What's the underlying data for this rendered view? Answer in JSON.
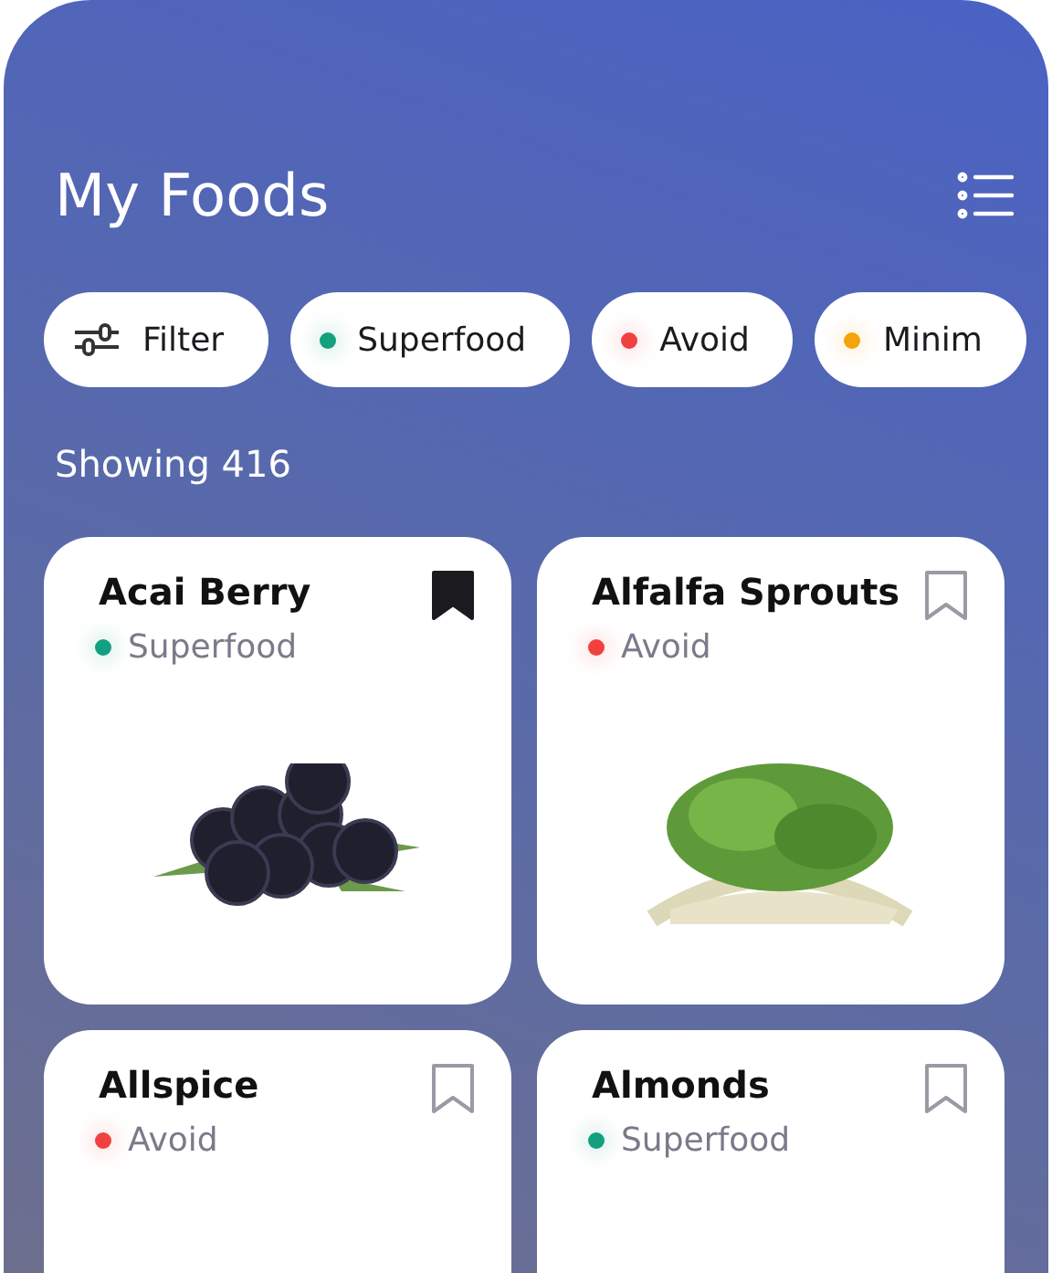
{
  "header": {
    "title": "My Foods"
  },
  "chips": [
    {
      "kind": "filter",
      "label": "Filter"
    },
    {
      "kind": "category",
      "label": "Superfood",
      "color": "#12a07e"
    },
    {
      "kind": "category",
      "label": "Avoid",
      "color": "#f04040"
    },
    {
      "kind": "category",
      "label": "Minim",
      "color": "#f5a30a"
    }
  ],
  "count": "Showing 416",
  "foods": [
    {
      "name": "Acai Berry",
      "category": "Superfood",
      "color": "#12a07e",
      "saved": true,
      "photo": {
        "kind": "berries"
      }
    },
    {
      "name": "Alfalfa Sprouts",
      "category": "Avoid",
      "color": "#f04040",
      "saved": false,
      "photo": {
        "kind": "sprouts"
      }
    },
    {
      "name": "Allspice",
      "category": "Avoid",
      "color": "#f04040",
      "saved": false
    },
    {
      "name": "Almonds",
      "category": "Superfood",
      "color": "#12a07e",
      "saved": false
    }
  ]
}
